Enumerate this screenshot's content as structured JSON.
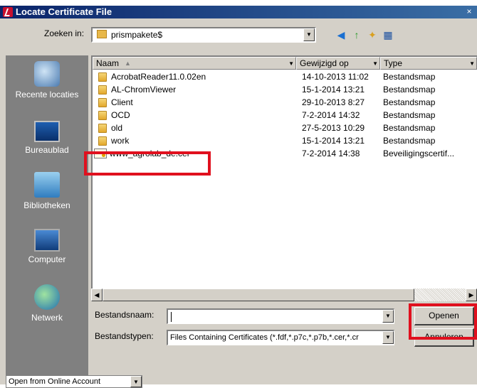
{
  "window": {
    "title": "Locate Certificate File",
    "close_glyph": "×"
  },
  "lookin": {
    "label": "Zoeken in:",
    "value": "prismpakete$"
  },
  "toolbar": {
    "back_glyph": "◀",
    "up_glyph": "↑",
    "newfolder_glyph": "✦",
    "view_glyph": "▦"
  },
  "places": [
    {
      "label": "Recente locaties",
      "icon": "recent-locations-icon"
    },
    {
      "label": "Bureaublad",
      "icon": "desktop-icon"
    },
    {
      "label": "Bibliotheken",
      "icon": "libraries-icon"
    },
    {
      "label": "Computer",
      "icon": "computer-icon"
    },
    {
      "label": "Netwerk",
      "icon": "network-icon"
    }
  ],
  "columns": {
    "name": "Naam",
    "modified": "Gewijzigd op",
    "type": "Type"
  },
  "files": [
    {
      "name": "AcrobatReader11.0.02en",
      "modified": "14-10-2013 11:02",
      "type": "Bestandsmap",
      "kind": "folder"
    },
    {
      "name": "AL-ChromViewer",
      "modified": "15-1-2014 13:21",
      "type": "Bestandsmap",
      "kind": "folder"
    },
    {
      "name": "Client",
      "modified": "29-10-2013 8:27",
      "type": "Bestandsmap",
      "kind": "folder"
    },
    {
      "name": "OCD",
      "modified": "7-2-2014 14:32",
      "type": "Bestandsmap",
      "kind": "folder"
    },
    {
      "name": "old",
      "modified": "27-5-2013 10:29",
      "type": "Bestandsmap",
      "kind": "folder"
    },
    {
      "name": "work",
      "modified": "15-1-2014 13:21",
      "type": "Bestandsmap",
      "kind": "folder"
    },
    {
      "name": "www_agrolab_de.cer",
      "modified": "7-2-2014 14:38",
      "type": "Beveiligingscertif...",
      "kind": "certificate"
    }
  ],
  "filename": {
    "label": "Bestandsnaam:",
    "value": ""
  },
  "filetype": {
    "label": "Bestandstypen:",
    "value": "Files Containing Certificates (*.fdf,*.p7c,*.p7b,*.cer,*.cr"
  },
  "buttons": {
    "open": "Openen",
    "cancel": "Annuleren"
  },
  "online": {
    "label": "Open from Online Account"
  },
  "highlight_color": "#e0101e"
}
